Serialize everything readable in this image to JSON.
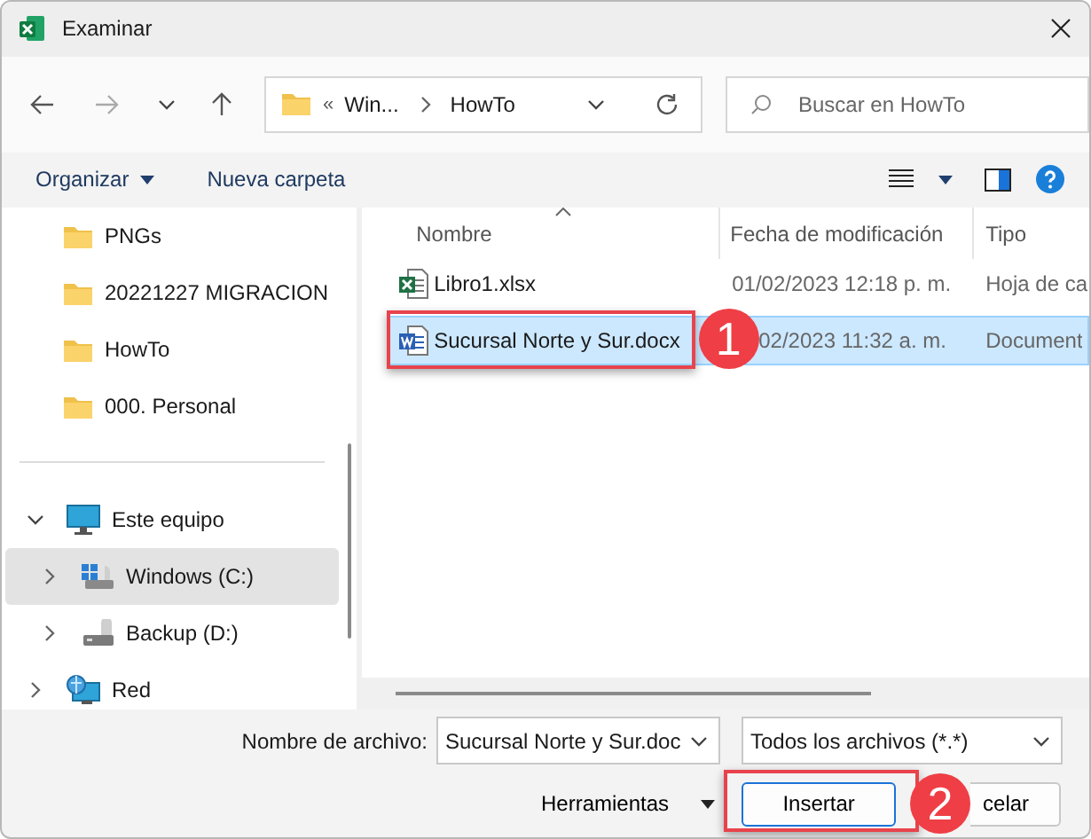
{
  "window": {
    "title": "Examinar"
  },
  "address": {
    "overflow": "«",
    "segments": [
      "Win...",
      "HowTo"
    ]
  },
  "search": {
    "placeholder": "Buscar en HowTo"
  },
  "toolbar": {
    "organize": "Organizar",
    "new_folder": "Nueva carpeta"
  },
  "sidebar": {
    "quick_access": [
      {
        "kind": "folder",
        "label": "PNGs"
      },
      {
        "kind": "folder",
        "label": "20221227 MIGRACION"
      },
      {
        "kind": "folder",
        "label": "HowTo"
      },
      {
        "kind": "folder",
        "label": "000. Personal"
      }
    ],
    "tree": [
      {
        "kind": "pc",
        "label": "Este equipo",
        "expanded": true,
        "selected": false,
        "children": [
          {
            "kind": "system-drive",
            "label": "Windows (C:)",
            "expanded": false,
            "selected": true
          },
          {
            "kind": "drive",
            "label": "Backup (D:)",
            "expanded": false,
            "selected": false
          }
        ]
      },
      {
        "kind": "network",
        "label": "Red",
        "expanded": false,
        "selected": false
      }
    ]
  },
  "files": {
    "columns": [
      "Nombre",
      "Fecha de modificación",
      "Tipo"
    ],
    "rows": [
      {
        "kind": "excel",
        "name": "Libro1.xlsx",
        "modified": "01/02/2023 12:18 p. m.",
        "type": "Hoja de ca",
        "selected": false
      },
      {
        "kind": "word",
        "name": "Sucursal Norte y Sur.docx",
        "modified": "02/2023 11:32 a. m.",
        "type": "Document",
        "selected": true,
        "annotation": "1"
      }
    ]
  },
  "footer": {
    "filename_label": "Nombre de archivo:",
    "filename": "Sucursal Norte y Sur.doc",
    "filter": "Todos los archivos (*.*)",
    "tools": "Herramientas",
    "buttons": [
      {
        "label": "Insertar",
        "default": true,
        "annotation": "2"
      },
      {
        "label": "celar",
        "default": false
      }
    ]
  }
}
